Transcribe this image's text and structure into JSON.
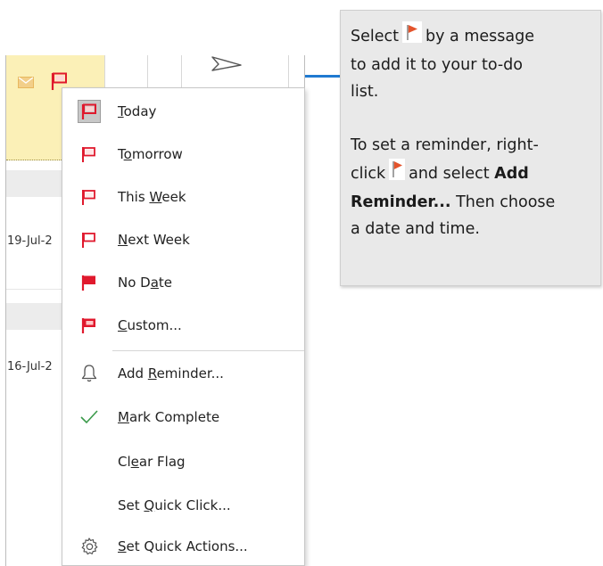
{
  "mail_list": {
    "dates": [
      "19-Jul-2",
      "16-Jul-2"
    ]
  },
  "callout": {
    "line1_before": "Select",
    "line1_after": "by a message",
    "line2": "to add it to your to-do",
    "line3": "list.",
    "line4": "To set a reminder, right-",
    "line5_before": "click",
    "line5_after": "and select",
    "line5_bold": "Add",
    "line6_bold": "Reminder...",
    "line6_after": " Then choose",
    "line7": "a date and time."
  },
  "menu": {
    "items": [
      {
        "id": "today",
        "pre": "",
        "key": "T",
        "post": "oday",
        "icon": "flag-today-icon"
      },
      {
        "id": "tomorrow",
        "pre": "T",
        "key": "o",
        "post": "morrow",
        "icon": "flag-tomorrow-icon"
      },
      {
        "id": "this-week",
        "pre": "This ",
        "key": "W",
        "post": "eek",
        "icon": "flag-this-week-icon"
      },
      {
        "id": "next-week",
        "pre": "",
        "key": "N",
        "post": "ext Week",
        "icon": "flag-next-week-icon"
      },
      {
        "id": "no-date",
        "pre": "No D",
        "key": "a",
        "post": "te",
        "icon": "flag-no-date-icon"
      },
      {
        "id": "custom",
        "pre": "",
        "key": "C",
        "post": "ustom...",
        "icon": "flag-custom-icon"
      },
      {
        "id": "add-reminder",
        "pre": "Add ",
        "key": "R",
        "post": "eminder...",
        "icon": "bell-icon"
      },
      {
        "id": "mark-complete",
        "pre": "",
        "key": "M",
        "post": "ark Complete",
        "icon": "checkmark-icon"
      },
      {
        "id": "clear-flag",
        "pre": "Cl",
        "key": "e",
        "post": "ar Flag",
        "icon": ""
      },
      {
        "id": "set-quick-click",
        "pre": "Set ",
        "key": "Q",
        "post": "uick Click...",
        "icon": ""
      },
      {
        "id": "set-quick-actions",
        "pre": "",
        "key": "S",
        "post": "et Quick Actions...",
        "icon": "gear-icon"
      }
    ]
  },
  "colors": {
    "flag_red": "#e0192d",
    "callout_flag": "#e4532b",
    "selected_row": "#fbf0b7",
    "connector": "#1f7ad1",
    "check_green": "#3a9a4a"
  }
}
